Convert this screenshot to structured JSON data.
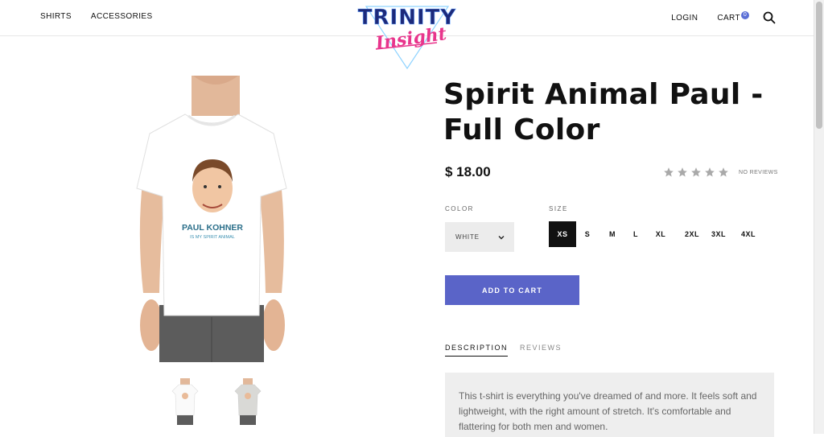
{
  "header": {
    "nav_left": [
      "SHIRTS",
      "ACCESSORIES"
    ],
    "login": "LOGIN",
    "cart_label": "CART",
    "cart_count": "0",
    "logo_text_1": "TRINITY",
    "logo_text_2": "Insight"
  },
  "product": {
    "title_line1": "Spirit Animal Paul -",
    "title_line2": "Full Color",
    "price": "$ 18.00",
    "rating_stars": 5,
    "reviews_label": "NO REVIEWS",
    "shirt_name": "PAUL KOHNER",
    "shirt_tagline": "IS MY SPIRIT ANIMAL",
    "color_label": "COLOR",
    "color_value": "WHITE",
    "size_label": "SIZE",
    "sizes": [
      "XS",
      "S",
      "M",
      "L",
      "XL",
      "2XL",
      "3XL",
      "4XL"
    ],
    "selected_size": "XS",
    "add_to_cart": "ADD TO CART"
  },
  "tabs": {
    "description": "DESCRIPTION",
    "reviews": "REVIEWS"
  },
  "description_text": "This t-shirt is everything you've dreamed of and more. It feels soft and lightweight, with the right amount of stretch. It's comfortable and flattering for both men and women.",
  "colors": {
    "accent": "#5a64c8",
    "badge": "#5b6fd6",
    "logo_blue": "#1d2a7a",
    "logo_pink": "#e8358c"
  }
}
